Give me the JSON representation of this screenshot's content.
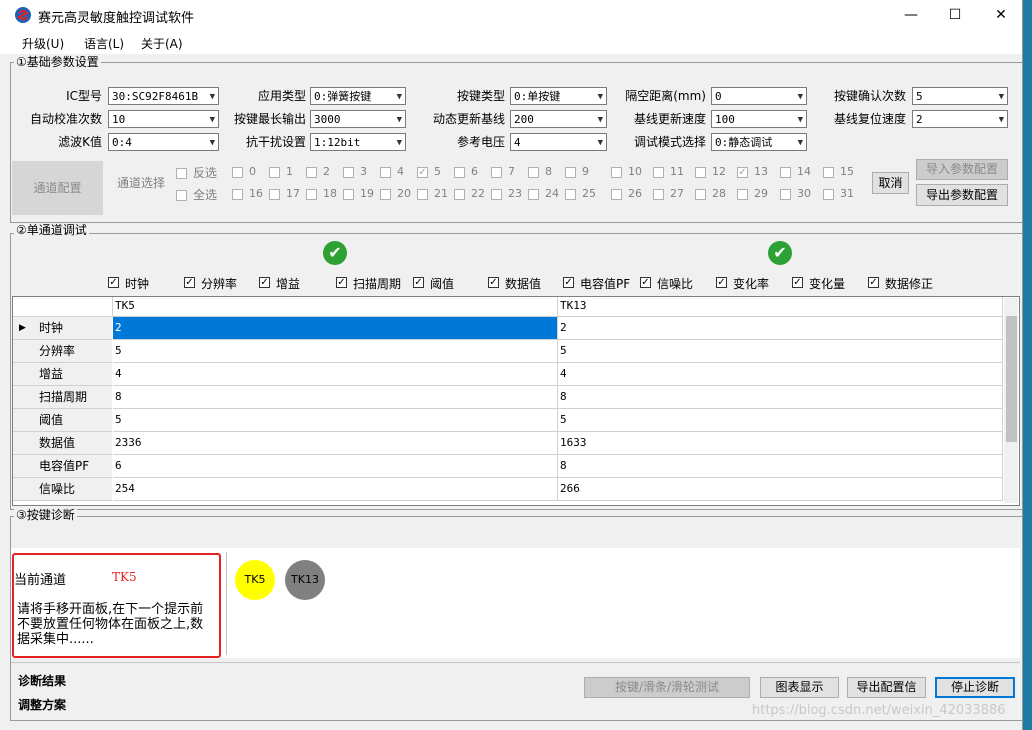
{
  "window": {
    "title": "赛元高灵敏度触控调试软件",
    "minimize": "—",
    "maximize": "☐",
    "close": "✕"
  },
  "menu": [
    "升级(U)",
    "语言(L)",
    "关于(A)"
  ],
  "basic": {
    "legend": "①基础参数设置",
    "fields": [
      {
        "label": "IC型号",
        "value": "30:SC92F8461B"
      },
      {
        "label": "应用类型",
        "value": "0:弹簧按键"
      },
      {
        "label": "按键类型",
        "value": "0:单按键"
      },
      {
        "label": "隔空距离(mm)",
        "value": "0"
      },
      {
        "label": "按键确认次数",
        "value": "5"
      },
      {
        "label": "自动校准次数",
        "value": "10"
      },
      {
        "label": "按键最长输出",
        "value": "3000"
      },
      {
        "label": "动态更新基线",
        "value": "200"
      },
      {
        "label": "基线更新速度",
        "value": "100"
      },
      {
        "label": "基线复位速度",
        "value": "2"
      },
      {
        "label": "滤波K值",
        "value": "0:4"
      },
      {
        "label": "抗干扰设置",
        "value": "1:12bit"
      },
      {
        "label": "参考电压",
        "value": "4"
      },
      {
        "label": "调试模式选择",
        "value": "0:静态调试"
      }
    ],
    "channel_config": "通道配置",
    "channel_select": "通道选择",
    "invert": "反选",
    "select_all": "全选",
    "channels_row1": [
      "0",
      "1",
      "2",
      "3",
      "4",
      "5",
      "6",
      "7",
      "8",
      "9",
      "10",
      "11",
      "12",
      "13",
      "14",
      "15"
    ],
    "channels_row2": [
      "16",
      "17",
      "18",
      "19",
      "20",
      "21",
      "22",
      "23",
      "24",
      "25",
      "26",
      "27",
      "28",
      "29",
      "30",
      "31"
    ],
    "checked_channels": [
      "5",
      "13"
    ],
    "cancel": "取消",
    "import": "导入参数配置",
    "export": "导出参数配置"
  },
  "single": {
    "legend": "②单通道调试",
    "checks": [
      "时钟",
      "分辨率",
      "增益",
      "扫描周期",
      "阈值",
      "数据值",
      "电容值PF",
      "信噪比",
      "变化率",
      "变化量",
      "数据修正"
    ],
    "ok_mark": "✔",
    "columns": [
      "TK5",
      "TK13"
    ],
    "rows": [
      {
        "name": "时钟",
        "tk5": "2",
        "tk13": "2"
      },
      {
        "name": "分辨率",
        "tk5": "5",
        "tk13": "5"
      },
      {
        "name": "增益",
        "tk5": "4",
        "tk13": "4"
      },
      {
        "name": "扫描周期",
        "tk5": "8",
        "tk13": "8"
      },
      {
        "name": "阈值",
        "tk5": "5",
        "tk13": "5"
      },
      {
        "name": "数据值",
        "tk5": "2336",
        "tk13": "1633"
      },
      {
        "name": "电容值PF",
        "tk5": "6",
        "tk13": "8"
      },
      {
        "name": "信噪比",
        "tk5": "254",
        "tk13": "266"
      }
    ],
    "row_pointer": "▶"
  },
  "diag": {
    "legend": "③按键诊断",
    "current_label": "当前通道",
    "current_value": "TK5",
    "message": "请将手移开面板,在下一个提示前不要放置任何物体在面板之上,数据采集中......",
    "keys": [
      {
        "label": "TK5",
        "color": "#ffff00"
      },
      {
        "label": "TK13",
        "color": "#808080"
      }
    ],
    "result_label": "诊断结果",
    "plan_label": "调整方案",
    "btn_slider": "按键/滑条/滑轮测试",
    "btn_chart": "图表显示",
    "btn_export": "导出配置信",
    "btn_stop": "停止诊断"
  },
  "watermark": "https://blog.csdn.net/weixin_42033886"
}
